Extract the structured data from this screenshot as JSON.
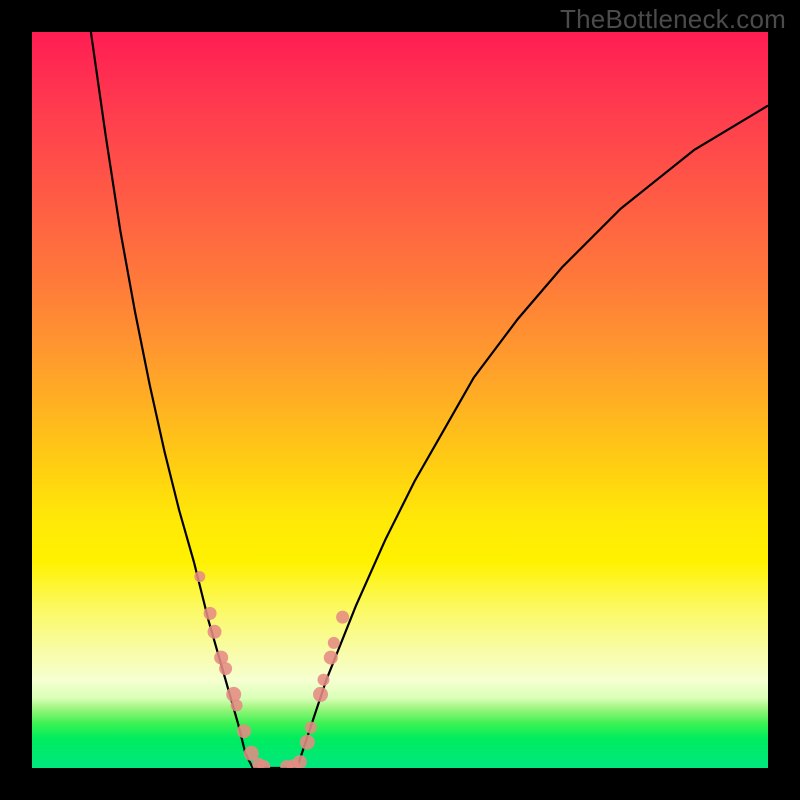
{
  "watermark": "TheBottleneck.com",
  "colors": {
    "frame": "#000000",
    "marker": "#e58b83",
    "curve": "#000000"
  },
  "chart_data": {
    "type": "line",
    "title": "",
    "xlabel": "",
    "ylabel": "",
    "xlim": [
      0,
      100
    ],
    "ylim": [
      0,
      100
    ],
    "grid": false,
    "legend": false,
    "curve_left": {
      "x": [
        8,
        10,
        12,
        14,
        16,
        18,
        20,
        22,
        24,
        26,
        28,
        29,
        30
      ],
      "y": [
        100,
        86,
        73,
        62,
        52,
        43,
        35,
        28,
        20,
        13,
        6,
        2,
        0
      ]
    },
    "trough": {
      "x": [
        30,
        31,
        32,
        33,
        34,
        35,
        36
      ],
      "y": [
        0,
        0,
        0,
        0,
        0,
        0,
        0
      ]
    },
    "curve_right": {
      "x": [
        36,
        38,
        40,
        44,
        48,
        52,
        56,
        60,
        66,
        72,
        80,
        90,
        100
      ],
      "y": [
        0,
        6,
        12,
        22,
        31,
        39,
        46,
        53,
        61,
        68,
        76,
        84,
        90
      ]
    },
    "markers_left": {
      "x": [
        22.8,
        24.2,
        24.8,
        25.7,
        26.3,
        27.4,
        27.8,
        28.8,
        29.8,
        30.8,
        31.5
      ],
      "y": [
        26.0,
        21.0,
        18.5,
        15.0,
        13.5,
        10.0,
        8.5,
        5.0,
        2.0,
        0.5,
        0.2
      ],
      "r": [
        5.5,
        6.5,
        7.0,
        7.0,
        6.5,
        7.5,
        6.0,
        7.0,
        7.5,
        6.5,
        6.5
      ]
    },
    "markers_right": {
      "x": [
        34.6,
        35.5,
        36.4,
        37.4,
        37.9,
        39.2,
        39.6,
        40.6,
        41.0,
        42.2
      ],
      "y": [
        0.2,
        0.3,
        0.8,
        3.5,
        5.5,
        10.0,
        12.0,
        15.0,
        17.0,
        20.5
      ],
      "r": [
        6.5,
        6.5,
        7.0,
        7.5,
        6.0,
        7.5,
        6.0,
        7.0,
        6.0,
        6.5
      ]
    }
  }
}
